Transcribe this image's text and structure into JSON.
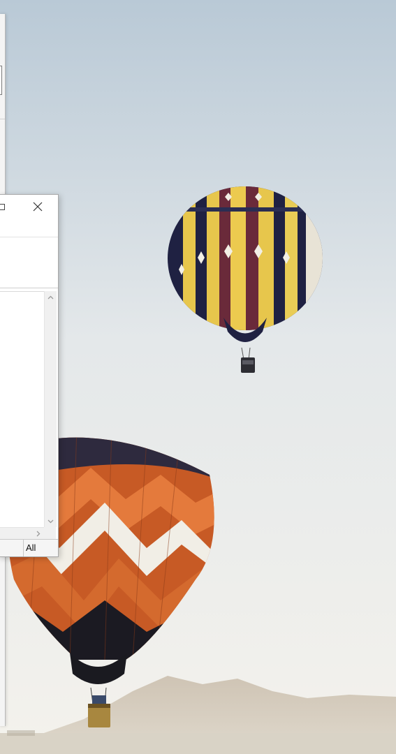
{
  "wallpaper": {
    "sky_top": "#b9c9d6",
    "sky_bottom": "#f4f2ec",
    "mountain_color": "#cbbfae"
  },
  "front_window": {
    "title_buttons": {
      "restore_icon": "restore-icon",
      "close_icon": "close-icon"
    },
    "status_bar": {
      "filter_label": "All"
    }
  }
}
